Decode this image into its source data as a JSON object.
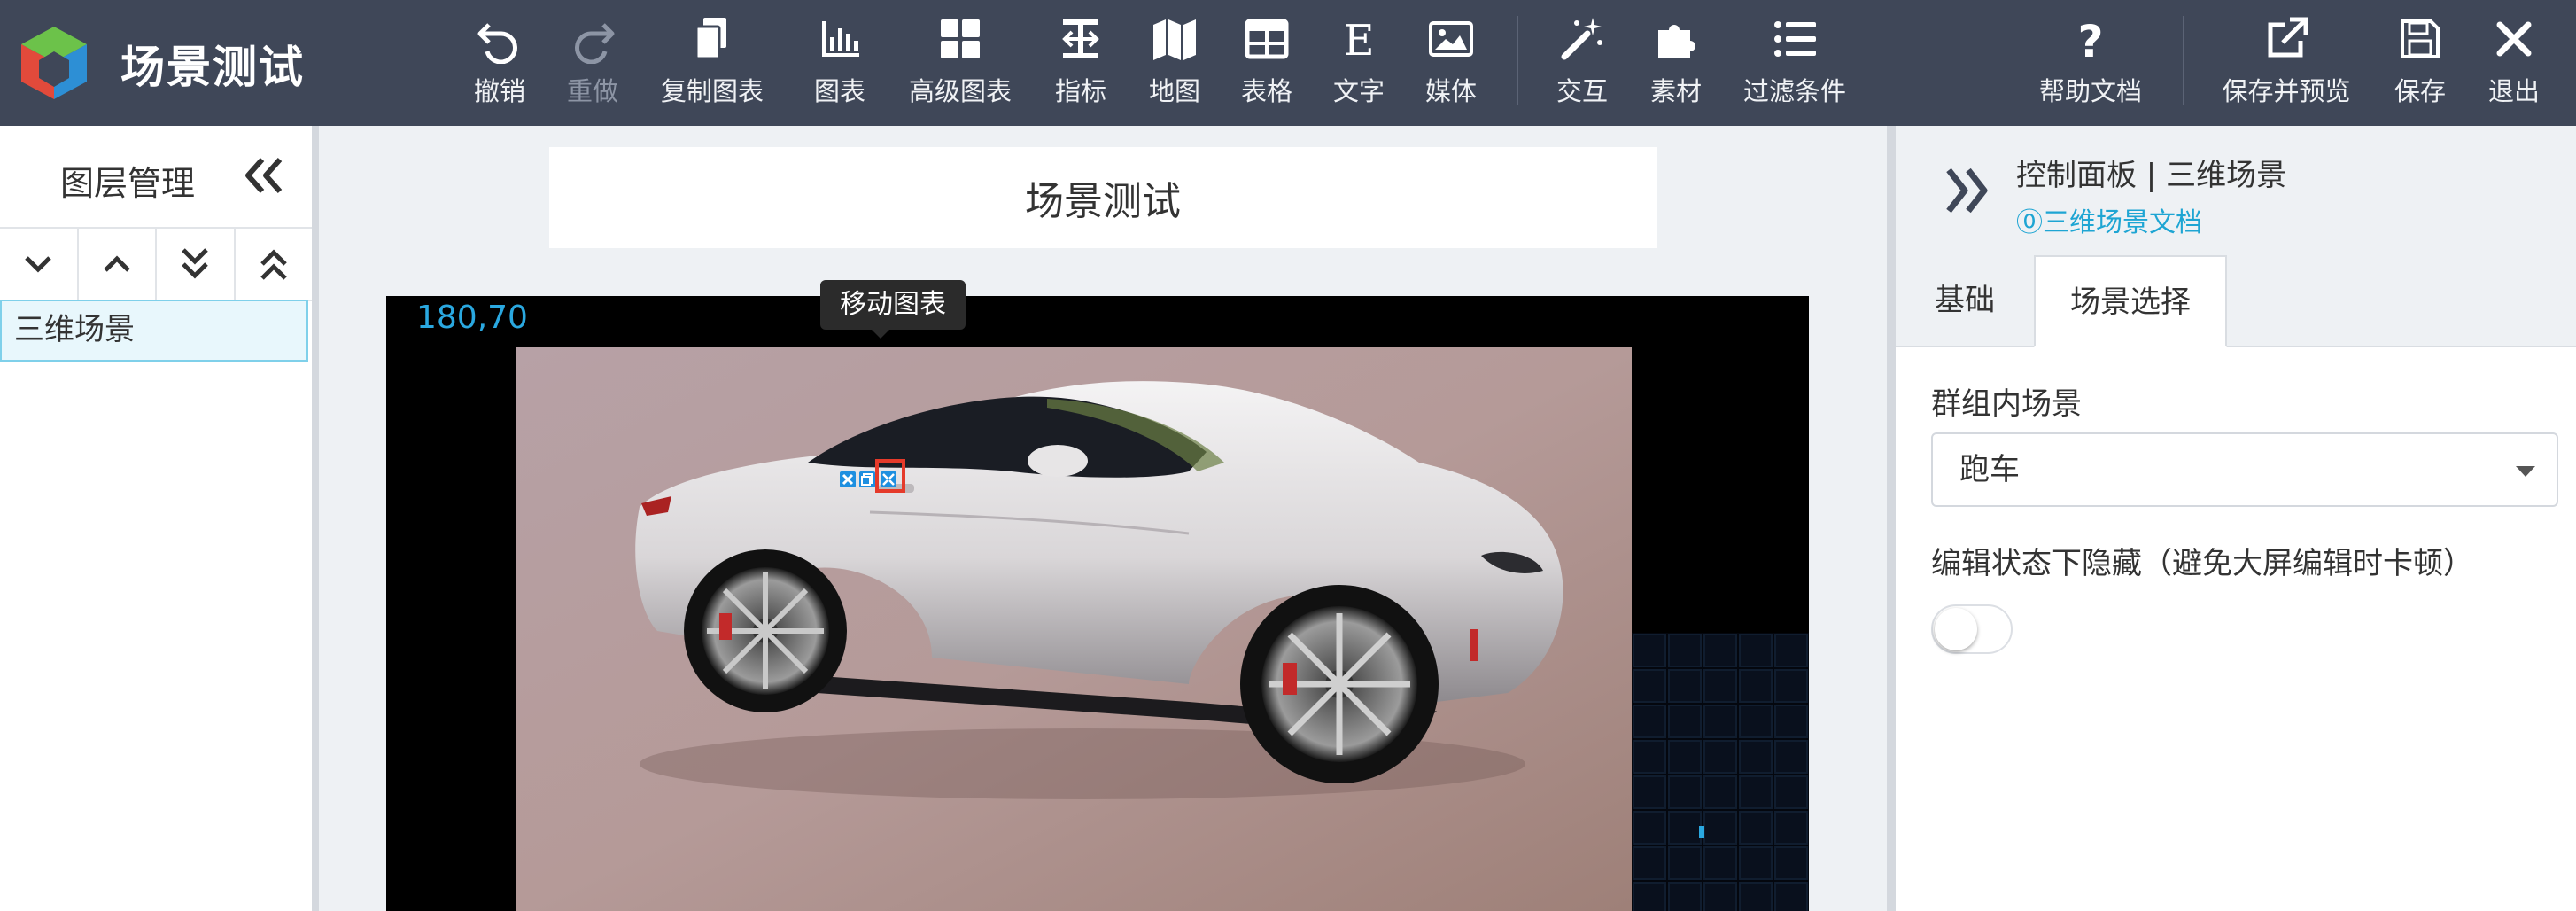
{
  "app": {
    "title": "场景测试"
  },
  "toolbar": {
    "undo": "撤销",
    "redo": "重做",
    "copy_chart": "复制图表",
    "chart": "图表",
    "advanced_chart": "高级图表",
    "indicator": "指标",
    "map": "地图",
    "table": "表格",
    "text": "文字",
    "media": "媒体",
    "interaction": "交互",
    "material": "素材",
    "filter": "过滤条件",
    "help": "帮助文档",
    "save_preview": "保存并预览",
    "save": "保存",
    "exit": "退出"
  },
  "layers": {
    "title": "图层管理",
    "items": [
      {
        "label": "三维场景",
        "selected": true
      }
    ]
  },
  "canvas": {
    "scene_title": "场景测试",
    "coords": "180,70",
    "tooltip": "移动图表"
  },
  "panel": {
    "title": "控制面板 | 三维场景",
    "doc_link": "⓪三维场景文档",
    "tabs": [
      {
        "label": "基础",
        "active": false
      },
      {
        "label": "场景选择",
        "active": true
      }
    ],
    "group_scene_label": "群组内场景",
    "group_scene_value": "跑车",
    "hide_label": "编辑状态下隐藏（避免大屏编辑时卡顿）",
    "hide_enabled": false
  },
  "colors": {
    "topbar": "#3f4758",
    "accent": "#1ea5d3",
    "highlight": "#e53a2a"
  }
}
